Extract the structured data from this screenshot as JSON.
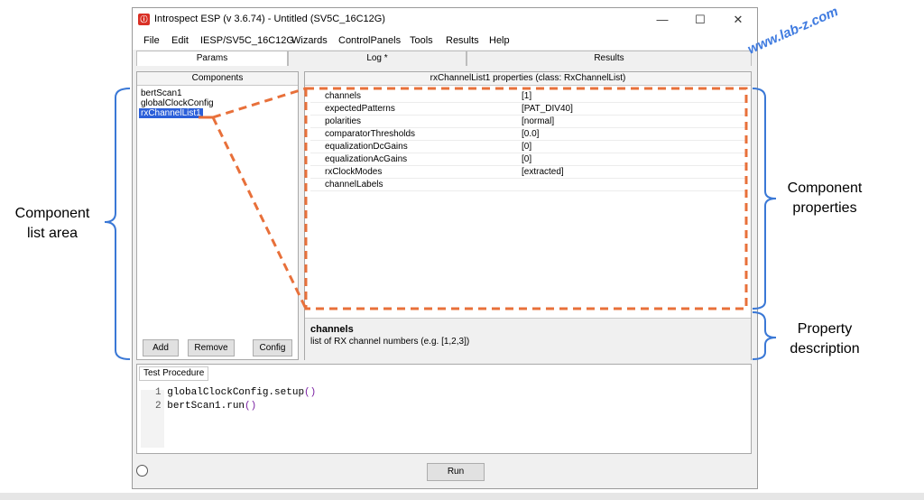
{
  "window": {
    "title": "Introspect ESP (v 3.6.74) - Untitled (SV5C_16C12G)",
    "controls": {
      "minimize": "—",
      "maximize": "☐",
      "close": "✕"
    }
  },
  "menu": [
    "File",
    "Edit",
    "IESP/SV5C_16C12G",
    "Wizards",
    "ControlPanels",
    "Tools",
    "Results",
    "Help"
  ],
  "tabs": [
    "Params",
    "Log *",
    "Results"
  ],
  "components": {
    "header": "Components",
    "items": [
      "bertScan1",
      "globalClockConfig",
      "rxChannelList1"
    ],
    "selected_index": 2,
    "buttons": {
      "add": "Add",
      "remove": "Remove",
      "config": "Config"
    }
  },
  "properties": {
    "header": "rxChannelList1 properties (class: RxChannelList)",
    "rows": [
      {
        "name": "channels",
        "value": "[1]"
      },
      {
        "name": "expectedPatterns",
        "value": "[PAT_DIV40]"
      },
      {
        "name": "polarities",
        "value": "[normal]"
      },
      {
        "name": "comparatorThresholds",
        "value": "[0.0]"
      },
      {
        "name": "equalizationDcGains",
        "value": "[0]"
      },
      {
        "name": "equalizationAcGains",
        "value": "[0]"
      },
      {
        "name": "rxClockModes",
        "value": "[extracted]"
      },
      {
        "name": "channelLabels",
        "value": ""
      }
    ],
    "description": {
      "title": "channels",
      "text": "list of RX channel numbers (e.g. [1,2,3])"
    }
  },
  "test_procedure": {
    "tab": "Test Procedure",
    "lines": [
      {
        "num": "1",
        "code": "globalClockConfig.setup",
        "parens": "()"
      },
      {
        "num": "2",
        "code": "bertScan1.run",
        "parens": "()"
      }
    ]
  },
  "footer": {
    "run_label": "Run"
  },
  "annotations": {
    "left": [
      "Component",
      "list area"
    ],
    "right_top": [
      "Component",
      "properties"
    ],
    "right_bottom": [
      "Property",
      "description"
    ],
    "accent": "#e8703a",
    "bracket": "#3a78d6"
  },
  "watermark": "www.lab-z.com"
}
